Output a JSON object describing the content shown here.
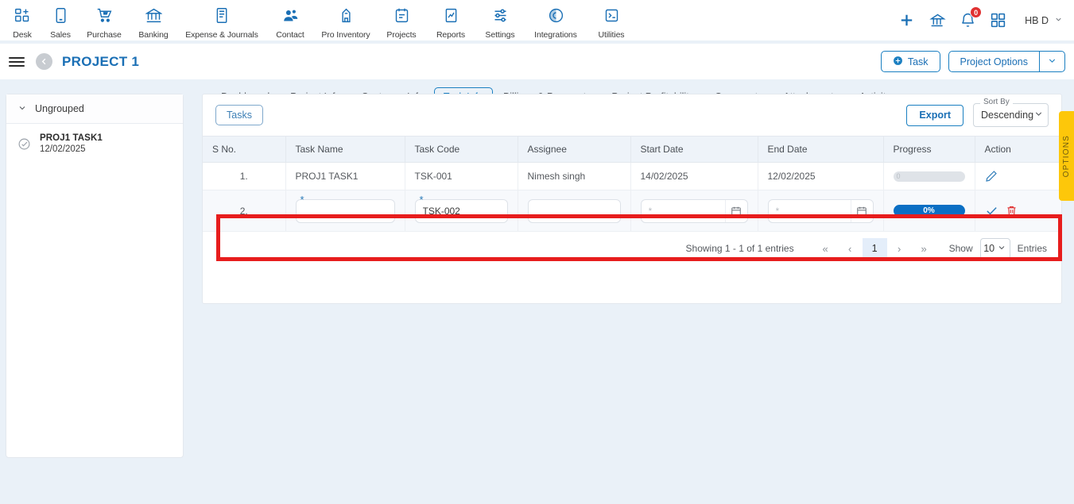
{
  "topnav": {
    "modules": [
      {
        "label": "Desk",
        "icon": "desk-icon"
      },
      {
        "label": "Sales",
        "icon": "sales-icon"
      },
      {
        "label": "Purchase",
        "icon": "purchase-cart-icon"
      },
      {
        "label": "Banking",
        "icon": "bank-icon"
      },
      {
        "label": "Expense & Journals",
        "icon": "journal-icon"
      },
      {
        "label": "Contact",
        "icon": "contact-icon"
      },
      {
        "label": "Pro Inventory",
        "icon": "inventory-icon"
      },
      {
        "label": "Projects",
        "icon": "projects-icon"
      },
      {
        "label": "Reports",
        "icon": "reports-icon"
      },
      {
        "label": "Settings",
        "icon": "settings-sliders-icon"
      },
      {
        "label": "Integrations",
        "icon": "integrations-icon"
      },
      {
        "label": "Utilities",
        "icon": "utilities-icon"
      }
    ],
    "add_icon": "plus-icon",
    "org_icon": "organization-icon",
    "notification_icon": "bell-icon",
    "notification_count": "0",
    "apps_icon": "grid-apps-icon",
    "user_initials": "HB D",
    "user_chevron": "chevron-down-icon"
  },
  "project_header": {
    "menu_icon": "hamburger-menu-icon",
    "back_icon": "back-arrow-icon",
    "title": "PROJECT 1",
    "task_button": "Task",
    "task_button_icon": "plus-circle-icon",
    "project_options_button": "Project Options",
    "project_options_chevron": "chevron-down-icon"
  },
  "sidebar": {
    "group_label": "Ungrouped",
    "group_chevron": "chevron-down-icon",
    "tasks": [
      {
        "name": "PROJ1 TASK1",
        "date": "12/02/2025",
        "icon": "check-circle-icon"
      }
    ]
  },
  "tabs": [
    {
      "label": "Dashboard",
      "active": false
    },
    {
      "label": "Project Info",
      "active": false
    },
    {
      "label": "Customer Info",
      "active": false
    },
    {
      "label": "Task Info",
      "active": true
    },
    {
      "label": "Billings & Payments",
      "active": false
    },
    {
      "label": "Project Profitability",
      "active": false
    },
    {
      "label": "Comments",
      "active": false
    },
    {
      "label": "Attachments",
      "active": false
    },
    {
      "label": "Activity",
      "active": false
    }
  ],
  "toolbar": {
    "tasks_pill": "Tasks",
    "export_button": "Export",
    "sort_by_legend": "Sort By",
    "sort_by_value": "Descending",
    "sort_chevron": "chevron-down-icon"
  },
  "table": {
    "headers": [
      "S No.",
      "Task Name",
      "Task Code",
      "Assignee",
      "Start Date",
      "End Date",
      "Progress",
      "Action"
    ],
    "rows": [
      {
        "sno": "1.",
        "task_name": "PROJ1 TASK1",
        "task_code": "TSK-001",
        "assignee": "Nimesh singh",
        "start_date": "14/02/2025",
        "end_date": "12/02/2025",
        "progress_label": "0",
        "progress_percent": 0,
        "action_icons": [
          "edit-pencil-icon"
        ]
      }
    ],
    "edit_row": {
      "sno": "2.",
      "task_name_value": "",
      "task_name_placeholder": "*",
      "task_code_value": "TSK-002",
      "task_code_required": "*",
      "assignee_value": "",
      "assignee_placeholder": "",
      "start_date_value": "",
      "start_date_placeholder": "*",
      "start_date_icon": "calendar-icon",
      "end_date_value": "",
      "end_date_placeholder": "*",
      "end_date_icon": "calendar-icon",
      "progress_label": "0%",
      "progress_percent": 0,
      "save_icon": "check-icon",
      "delete_icon": "trash-icon"
    }
  },
  "pagination": {
    "info": "Showing 1 - 1 of 1 entries",
    "first": "«",
    "prev": "‹",
    "current_page": "1",
    "next": "›",
    "last": "»",
    "show_label": "Show",
    "page_size": "10",
    "page_size_chevron": "chevron-down-icon",
    "entries_label": "Entries"
  },
  "options_tab": {
    "label": "OPTIONS"
  },
  "colors": {
    "brand_blue": "#1a6fb5",
    "accent_blue": "#1a7fc1",
    "progress_blue": "#0b6fc4",
    "danger_red": "#e03131",
    "annotation_red": "#e71d1d",
    "options_yellow": "#fdc70a",
    "page_background": "#eaf1f8"
  }
}
